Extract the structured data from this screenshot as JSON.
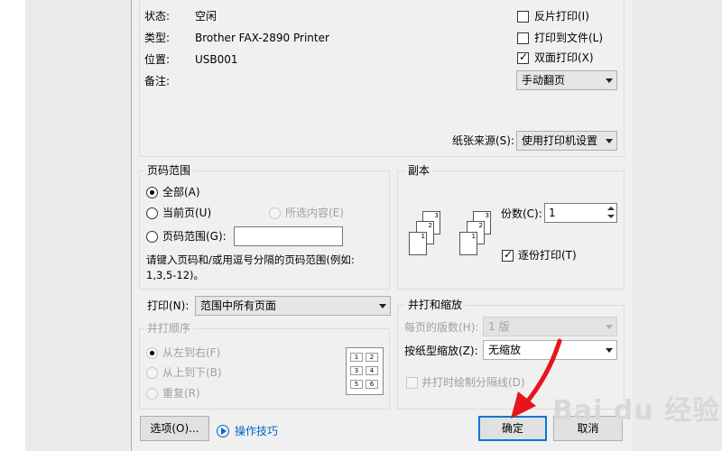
{
  "printer": {
    "status_label": "状态:",
    "status_value": "空闲",
    "type_label": "类型:",
    "type_value": "Brother FAX-2890 Printer",
    "where_label": "位置:",
    "where_value": "USB001",
    "comment_label": "备注:"
  },
  "options": {
    "reverse_print": {
      "label": "反片打印(I)",
      "checked": false
    },
    "print_to_file": {
      "label": "打印到文件(L)",
      "checked": false
    },
    "duplex": {
      "label": "双面打印(X)",
      "checked": true
    },
    "duplex_mode": "手动翻页",
    "paper_source_label": "纸张来源(S):",
    "paper_source_value": "使用打印机设置"
  },
  "page_range": {
    "title": "页码范围",
    "all": "全部(A)",
    "current": "当前页(U)",
    "selection": "所选内容(E)",
    "pages": "页码范围(G):",
    "pages_value": "",
    "hint_line1": "请键入页码和/或用逗号分隔的页码范围(例如:",
    "hint_line2": "1,3,5-12)。",
    "selected": "all"
  },
  "copies": {
    "title": "副本",
    "count_label": "份数(C):",
    "count_value": "1",
    "collate_label": "逐份打印(T)",
    "collate_checked": true
  },
  "print_what": {
    "label": "打印(N):",
    "value": "范围中所有页面"
  },
  "collate_order": {
    "title": "并打顺序",
    "left_to_right": "从左到右(F)",
    "top_to_bottom": "从上到下(B)",
    "repeat": "重复(R)"
  },
  "zoom": {
    "title": "并打和缩放",
    "pages_per_sheet_label": "每页的版数(H):",
    "pages_per_sheet_value": "1 版",
    "scale_label": "按纸型缩放(Z):",
    "scale_value": "无缩放",
    "draw_lines_label": "并打时绘制分隔线(D)"
  },
  "buttons": {
    "options": "选项(O)...",
    "tips": "操作技巧",
    "ok": "确定",
    "cancel": "取消"
  },
  "watermark": "Bai du 经验",
  "colors": {
    "arrow": "#e8141b",
    "default_button_border": "#0078d7"
  }
}
